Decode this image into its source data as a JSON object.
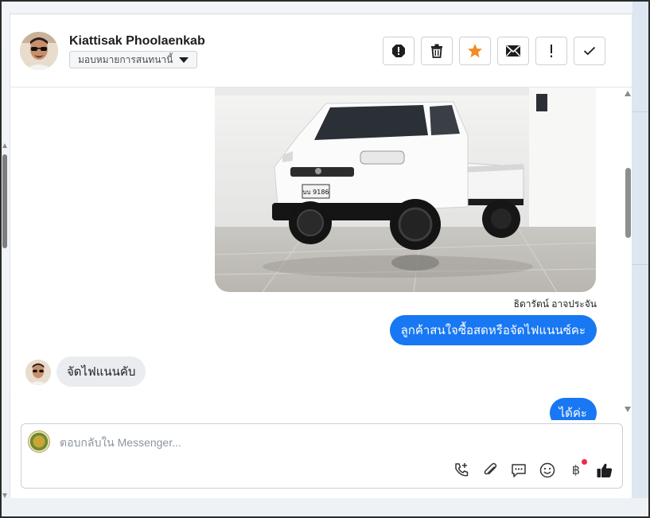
{
  "header": {
    "contact_name": "Kiattisak Phoolaenkab",
    "assign_label": "มอบหมายการสนทนานี้",
    "actions": [
      {
        "name": "spam-icon"
      },
      {
        "name": "trash-icon"
      },
      {
        "name": "star-icon"
      },
      {
        "name": "envelope-icon"
      },
      {
        "name": "exclamation-icon"
      },
      {
        "name": "checkmark-icon"
      }
    ]
  },
  "messages": {
    "image_alt": "white pickup truck in showroom",
    "sender_name": "ธิดารัตน์ อาจประจัน",
    "outgoing_1": "ลูกค้าสนใจซื้อสดหรือจัดไฟแนนซ์คะ",
    "incoming_1": "จัดไฟแนนคับ",
    "outgoing_2": "ได้ค่ะ"
  },
  "photo": {
    "plate_text": "บบ 9186"
  },
  "composer": {
    "placeholder": "ตอบกลับใน Messenger...",
    "tools": [
      "phone-plus-icon",
      "paperclip-icon",
      "chat-bubble-icon",
      "smiley-icon",
      "baht-icon",
      "thumbs-up-icon"
    ],
    "baht_symbol": "฿"
  },
  "colors": {
    "accent": "#1877f2",
    "star": "#f28c28",
    "notification": "#f02849"
  }
}
